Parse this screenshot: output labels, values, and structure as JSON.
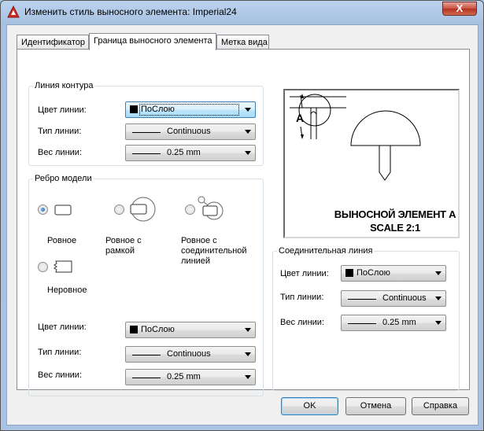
{
  "window": {
    "title": "Изменить стиль выносного элемента: Imperial24",
    "close_glyph": "X"
  },
  "tabs": [
    {
      "label": "Идентификатор",
      "active": false
    },
    {
      "label": "Граница выносного элемента",
      "active": true
    },
    {
      "label": "Метка вида",
      "active": false
    }
  ],
  "boundary_line": {
    "legend": "Линия контура",
    "color_label": "Цвет линии:",
    "color_value": "ПоСлою",
    "linetype_label": "Тип линии:",
    "linetype_value": "Continuous",
    "weight_label": "Вес линии:",
    "weight_value": "0.25 mm"
  },
  "model_edge": {
    "legend": "Ребро модели",
    "options": [
      {
        "label": "Ровное",
        "checked": true
      },
      {
        "label": "Ровное с рамкой",
        "checked": false
      },
      {
        "label": "Ровное с соединительной линией",
        "checked": false
      },
      {
        "label": "Неровное",
        "checked": false
      }
    ],
    "color_label": "Цвет линии:",
    "color_value": "ПоСлою",
    "linetype_label": "Тип линии:",
    "linetype_value": "Continuous",
    "weight_label": "Вес линии:",
    "weight_value": "0.25 mm"
  },
  "preview": {
    "label_letter": "A",
    "caption_line1": "ВЫНОСНОЙ ЭЛЕМЕНТ A",
    "caption_line2": "SCALE 2:1"
  },
  "connection_line": {
    "legend": "Соединительная линия",
    "color_label": "Цвет линии:",
    "color_value": "ПоСлою",
    "linetype_label": "Тип линии:",
    "linetype_value": "Continuous",
    "weight_label": "Вес линии:",
    "weight_value": "0.25 mm"
  },
  "buttons": {
    "ok": "OK",
    "cancel": "Отмена",
    "help": "Справка"
  },
  "colors": {
    "title_bar": "#a9c4e3",
    "close_button": "#c7513f",
    "radio_selected": "#1d5b9c"
  }
}
